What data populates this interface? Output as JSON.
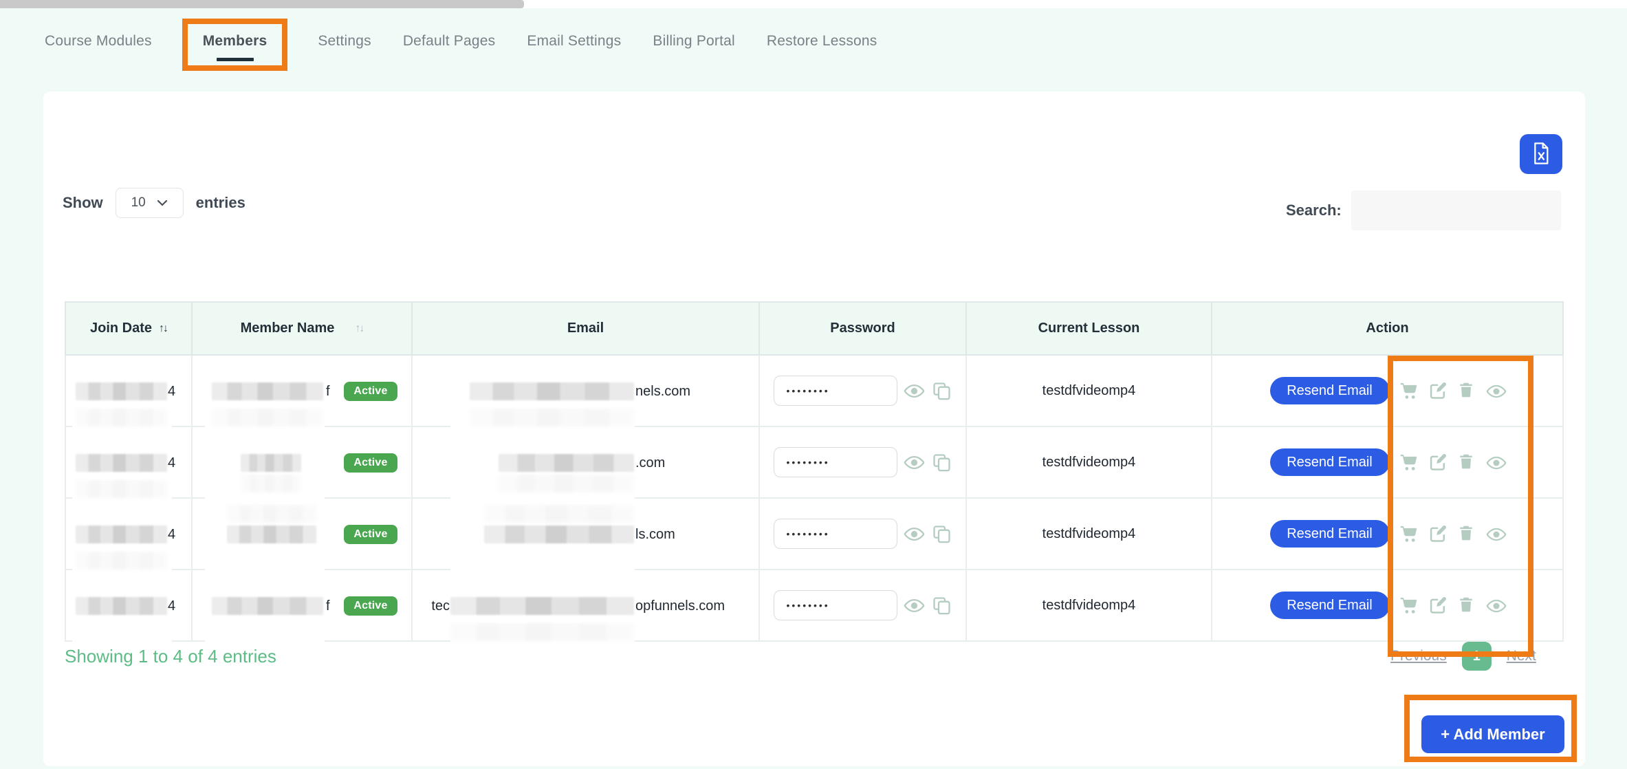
{
  "colors": {
    "accent_blue": "#2d5ce4",
    "active_badge_green": "#4aa64f",
    "pagination_green": "#68bb8f",
    "summary_green": "#5dbc85",
    "annotation_orange": "#ee7b16",
    "icon_sage": "#b5cdc1",
    "page_background": "#f0faf6",
    "header_row_background": "#eff9f4"
  },
  "tabs": [
    {
      "label": "Course Modules",
      "active": false
    },
    {
      "label": "Members",
      "active": true
    },
    {
      "label": "Settings",
      "active": false
    },
    {
      "label": "Default Pages",
      "active": false
    },
    {
      "label": "Email Settings",
      "active": false
    },
    {
      "label": "Billing Portal",
      "active": false
    },
    {
      "label": "Restore Lessons",
      "active": false
    }
  ],
  "toolbar": {
    "show_label": "Show",
    "page_size": "10",
    "entries_label": "entries",
    "search_label": "Search:",
    "search_value": "",
    "export_icon": "file-excel-icon"
  },
  "glyphs": {
    "sort": "↑↓"
  },
  "table": {
    "headers": {
      "join_date": "Join Date",
      "member_name": "Member Name",
      "email": "Email",
      "password": "Password",
      "current_lesson": "Current Lesson",
      "action": "Action"
    },
    "action": {
      "resend_label": "Resend Email"
    },
    "rows": [
      {
        "join_date_visible": "4",
        "name_visible": "f",
        "status": "Active",
        "email_prefix": "",
        "email_visible": "nels.com",
        "password_mask": "••••••••",
        "current_lesson": "testdfvideomp4"
      },
      {
        "join_date_visible": "4",
        "name_visible": "",
        "status": "Active",
        "email_prefix": "",
        "email_visible": ".com",
        "password_mask": "••••••••",
        "current_lesson": "testdfvideomp4"
      },
      {
        "join_date_visible": "4",
        "name_visible": "",
        "status": "Active",
        "email_prefix": "",
        "email_visible": "ls.com",
        "password_mask": "••••••••",
        "current_lesson": "testdfvideomp4"
      },
      {
        "join_date_visible": "4",
        "name_visible": "f",
        "status": "Active",
        "email_prefix": "tec",
        "email_visible": "opfunnels.com",
        "password_mask": "••••••••",
        "current_lesson": "testdfvideomp4"
      }
    ]
  },
  "footer": {
    "summary": "Showing 1 to 4 of 4 entries",
    "previous_label": "Previous",
    "page_number": "1",
    "next_label": "Next",
    "add_member_label": "+ Add Member"
  },
  "annotations": {
    "color": "#ee7b16",
    "targets": [
      "members-tab",
      "row-action-icons",
      "add-member-button"
    ]
  }
}
